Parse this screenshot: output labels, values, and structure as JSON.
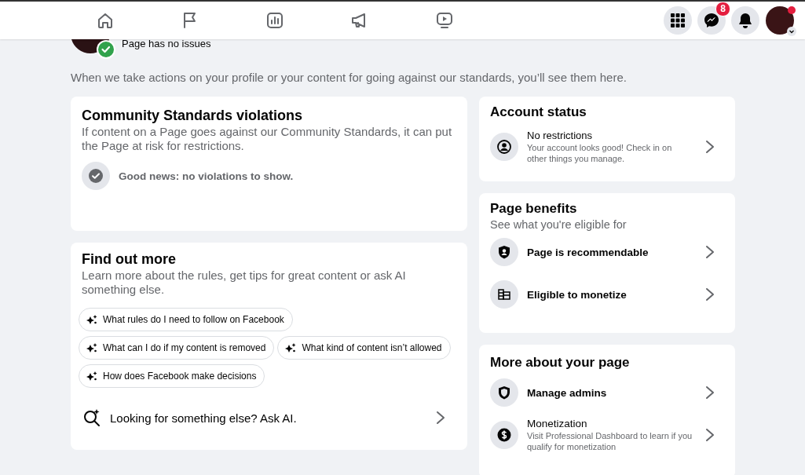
{
  "top_bar": {
    "messages_badge": "8"
  },
  "page_status": {
    "text": "Page has no issues",
    "verified": true
  },
  "intro": "When we take actions on your profile or your content for going against our standards, you’ll see them here.",
  "violations": {
    "title": "Community Standards violations",
    "description": "If content on a Page goes against our Community Standards, it can put the Page at risk for restrictions.",
    "status": "Good news: no violations to show."
  },
  "find_out_more": {
    "title": "Find out more",
    "description": "Learn more about the rules, get tips for great content or ask AI something else.",
    "suggestions": [
      "What rules do I need to follow on Facebook",
      "What can I do if my content is removed",
      "What kind of content isn’t allowed",
      "How does Facebook make decisions"
    ],
    "ask_ai": "Looking for something else? Ask AI."
  },
  "account_status": {
    "title": "Account status",
    "items": [
      {
        "title": "No restrictions",
        "subtitle": "Your account looks good! Check in on other things you manage."
      }
    ]
  },
  "page_benefits": {
    "title": "Page benefits",
    "subtitle": "See what you're eligible for",
    "items": [
      {
        "title": "Page is recommendable"
      },
      {
        "title": "Eligible to monetize"
      }
    ]
  },
  "more_about_page": {
    "title": "More about your page",
    "items": [
      {
        "title": "Manage admins"
      },
      {
        "title": "Monetization",
        "subtitle": "Visit Professional Dashboard to learn if you qualify for monetization"
      }
    ]
  }
}
